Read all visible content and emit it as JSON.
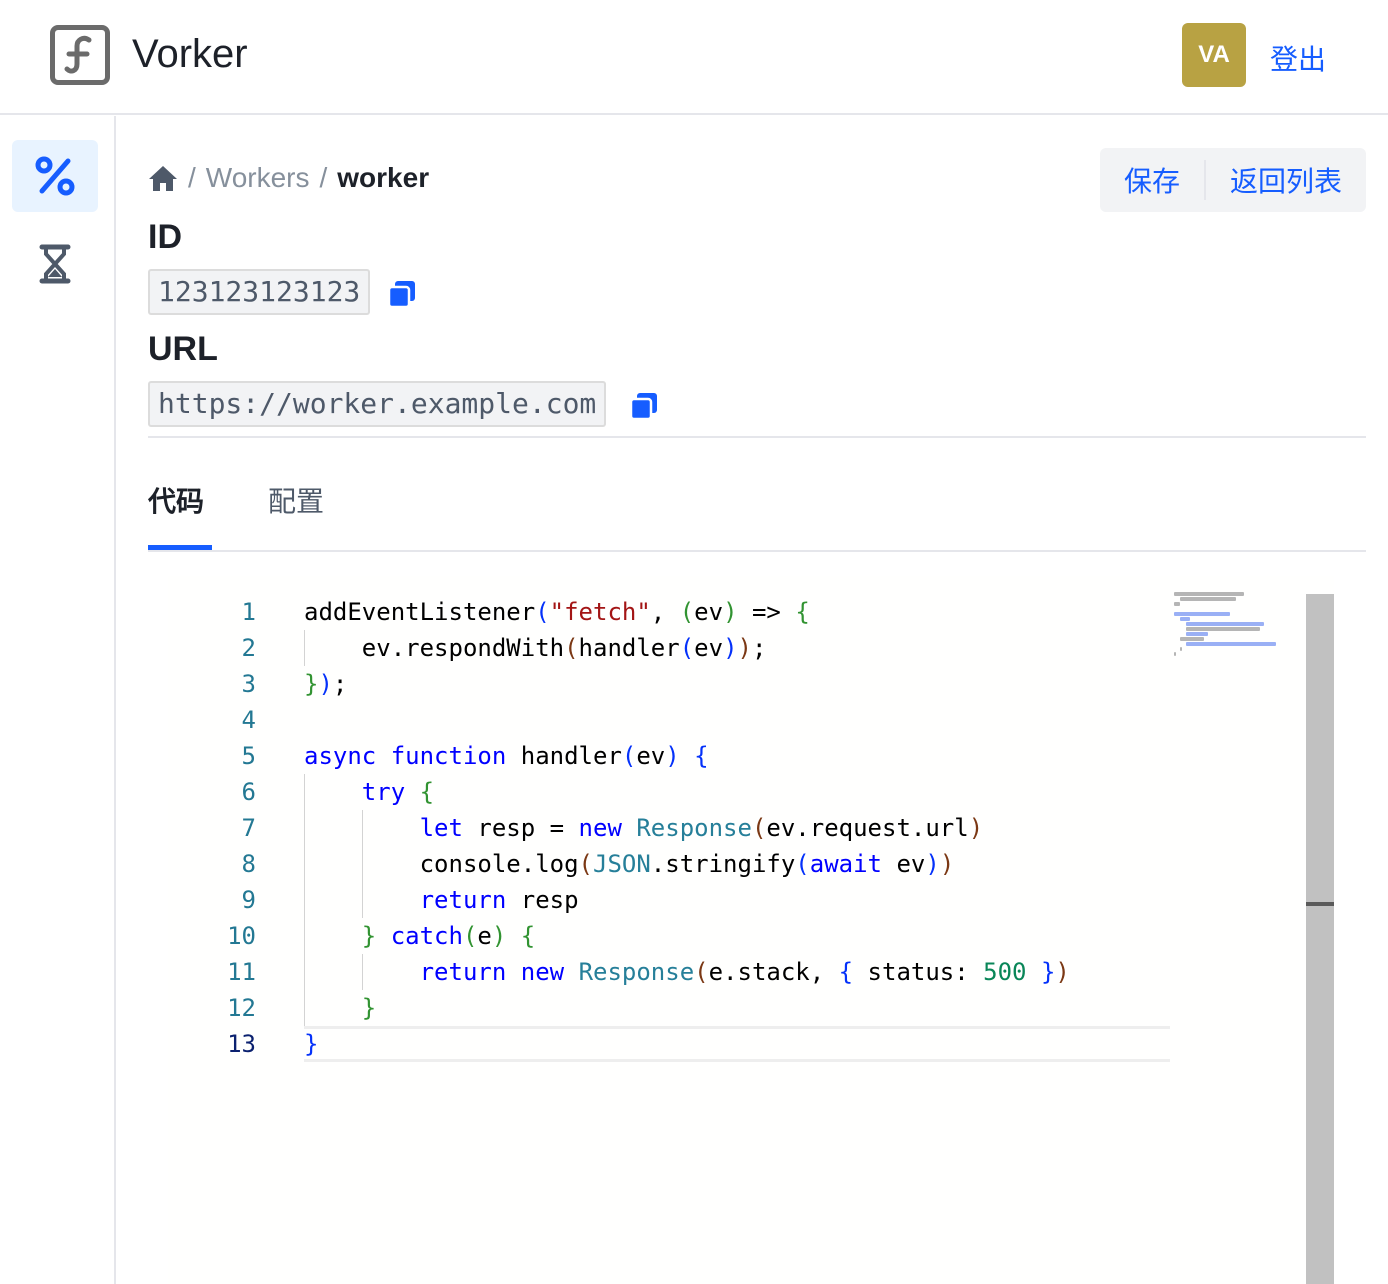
{
  "app": {
    "title": "Vorker",
    "logo_icon": "function-icon",
    "avatar_initials": "VA",
    "logout_label": "登出",
    "accent": "#165dff",
    "avatar_color": "#b8a243"
  },
  "sidebar": {
    "items": [
      {
        "icon": "percent-icon",
        "active": true
      },
      {
        "icon": "hourglass-icon",
        "active": false
      }
    ]
  },
  "breadcrumb": {
    "home_icon": "home-icon",
    "separator": "/",
    "items": [
      "Workers",
      "worker"
    ]
  },
  "actions": {
    "save_label": "保存",
    "back_label": "返回列表"
  },
  "fields": {
    "id_label": "ID",
    "id_value": "123123123123",
    "url_label": "URL",
    "url_value": "https://worker.example.com",
    "copy_icon": "copy-icon"
  },
  "tabs": [
    {
      "label": "代码",
      "active": true
    },
    {
      "label": "配置",
      "active": false
    }
  ],
  "editor": {
    "line_numbers": [
      "1",
      "2",
      "3",
      "4",
      "5",
      "6",
      "7",
      "8",
      "9",
      "10",
      "11",
      "12",
      "13"
    ],
    "current_line": 13,
    "lines": [
      "addEventListener(\"fetch\", (ev) => {",
      "    ev.respondWith(handler(ev));",
      "});",
      "",
      "async function handler(ev) {",
      "    try {",
      "        let resp = new Response(ev.request.url)",
      "        console.log(JSON.stringify(await ev))",
      "        return resp",
      "    } catch(e) {",
      "        return new Response(e.stack, { status: 500 })",
      "    }",
      "}"
    ]
  }
}
